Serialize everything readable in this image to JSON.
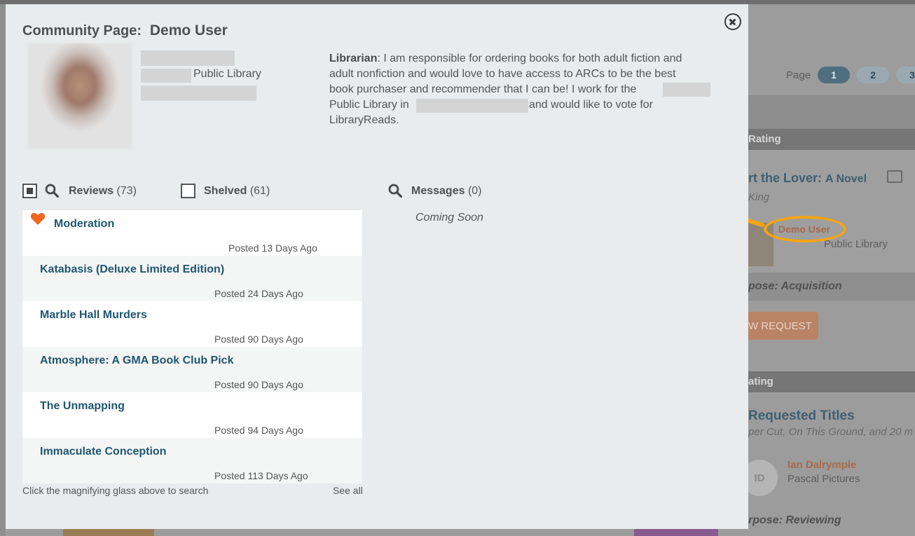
{
  "background": {
    "pager": {
      "label": "Page",
      "pages": [
        "1",
        "2",
        "3"
      ]
    },
    "section1_header": "Rating",
    "book_title": "rt the Lover:",
    "book_subtitle": "A Novel",
    "book_author": "King",
    "requester_name": "Demo User",
    "requester_library": "Public Library",
    "purpose1": "pose: Acquisition",
    "request_button": "W REQUEST",
    "section2_header": "ating",
    "requested_titles": "Requested Titles",
    "requested_titles_sub": "per Cut, On This Ground, and 20 m",
    "reviewer_initials": "ID",
    "reviewer_name": "Ian Dalrymple",
    "reviewer_org": "Pascal Pictures",
    "purpose2": "rpose: Reviewing"
  },
  "modal": {
    "title_prefix": "Community Page:",
    "title_name": "Demo User",
    "user_library_suffix": "Public Library",
    "bio": {
      "role": "Librarian",
      "line1": ": I am responsible for ordering books for both adult fiction and",
      "line2": "adult nonfiction and would love to have access to ARCs to be the best",
      "line3": "book purchaser and recommender that I can be! I work for the",
      "line4a": "Public Library in",
      "line4b": "and would like to vote for",
      "line5": "LibraryReads."
    },
    "tabs": {
      "reviews": {
        "label": "Reviews",
        "count": "(73)"
      },
      "shelved": {
        "label": "Shelved",
        "count": "(61)"
      },
      "messages": {
        "label": "Messages",
        "count": "(0)"
      }
    },
    "reviews": [
      {
        "title": "Moderation",
        "date": "Posted 13 Days Ago",
        "favorite": true
      },
      {
        "title": "Katabasis (Deluxe Limited Edition)",
        "date": "Posted 24 Days Ago",
        "favorite": false
      },
      {
        "title": "Marble Hall Murders",
        "date": "Posted 90 Days Ago",
        "favorite": false
      },
      {
        "title": "Atmosphere: A GMA Book Club Pick",
        "date": "Posted 90 Days Ago",
        "favorite": false
      },
      {
        "title": "The Unmapping",
        "date": "Posted 94 Days Ago",
        "favorite": false
      },
      {
        "title": "Immaculate Conception",
        "date": "Posted 113 Days Ago",
        "favorite": false
      }
    ],
    "search_hint": "Click the magnifying glass above to search",
    "see_all": "See all",
    "messages_placeholder": "Coming Soon"
  },
  "colors": {
    "accent_link": "#1f5670",
    "heart": "#f26522",
    "annotation": "#f5a512"
  }
}
